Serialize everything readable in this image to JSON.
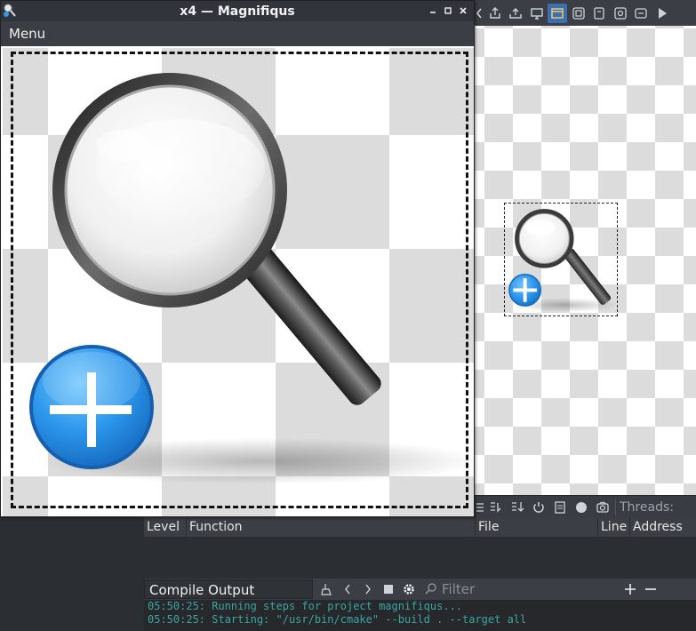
{
  "window": {
    "title": "x4 — Magnifiqus",
    "menu_label": "Menu",
    "controls": [
      "minimize",
      "maximize",
      "close"
    ]
  },
  "ide": {
    "toolbar_icons": [
      "split-view-icon",
      "upload-icon",
      "export-icon",
      "monitor-icon",
      "window-icon",
      "fit-icon",
      "page-icon",
      "settings-icon",
      "layout-icon",
      "play-icon"
    ],
    "debug_toolbar": {
      "threads_label": "Threads:"
    },
    "stack_columns": [
      "Level",
      "Function",
      "File",
      "Line",
      "Address"
    ],
    "output": {
      "selected_pane": "Compile Output",
      "filter_placeholder": "Filter",
      "lines": [
        "05:50:25: Running steps for project magnifiqus...",
        "05:50:25: Starting: \"/usr/bin/cmake\" --build . --target all"
      ]
    }
  },
  "colors": {
    "accent_blue": "#2e9ae9",
    "output_text": "#3aa6a0",
    "titlebar": "#31353b"
  }
}
